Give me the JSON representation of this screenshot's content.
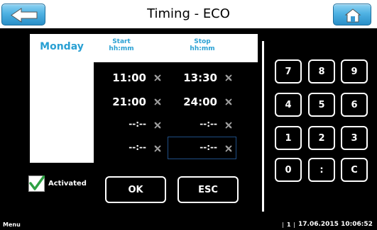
{
  "header": {
    "title": "Timing - ECO"
  },
  "schedule": {
    "day": "Monday",
    "start_header": [
      "Start",
      "hh:mm"
    ],
    "stop_header": [
      "Stop",
      "hh:mm"
    ],
    "rows": [
      {
        "start": "11:00",
        "stop": "13:30"
      },
      {
        "start": "21:00",
        "stop": "24:00"
      },
      {
        "start": "--:--",
        "stop": "--:--"
      },
      {
        "start": "--:--",
        "stop": "--:--"
      }
    ]
  },
  "activated": {
    "label": "Activated",
    "checked": true
  },
  "buttons": {
    "ok": "OK",
    "esc": "ESC"
  },
  "keypad": [
    "7",
    "8",
    "9",
    "4",
    "5",
    "6",
    "1",
    "2",
    "3",
    "0",
    ":",
    "C"
  ],
  "footer": {
    "menu": "Menu",
    "separator": "|",
    "page": "1",
    "datetime": "17.06.2015 10:06:52"
  },
  "colors": {
    "accent": "#29a0d3",
    "button": "#4fb2e3",
    "check": "#2ea043"
  },
  "icons": {
    "back": "arrow-left-icon",
    "home": "home-icon",
    "clear": "clear-x-icon",
    "check": "checkmark-icon"
  }
}
